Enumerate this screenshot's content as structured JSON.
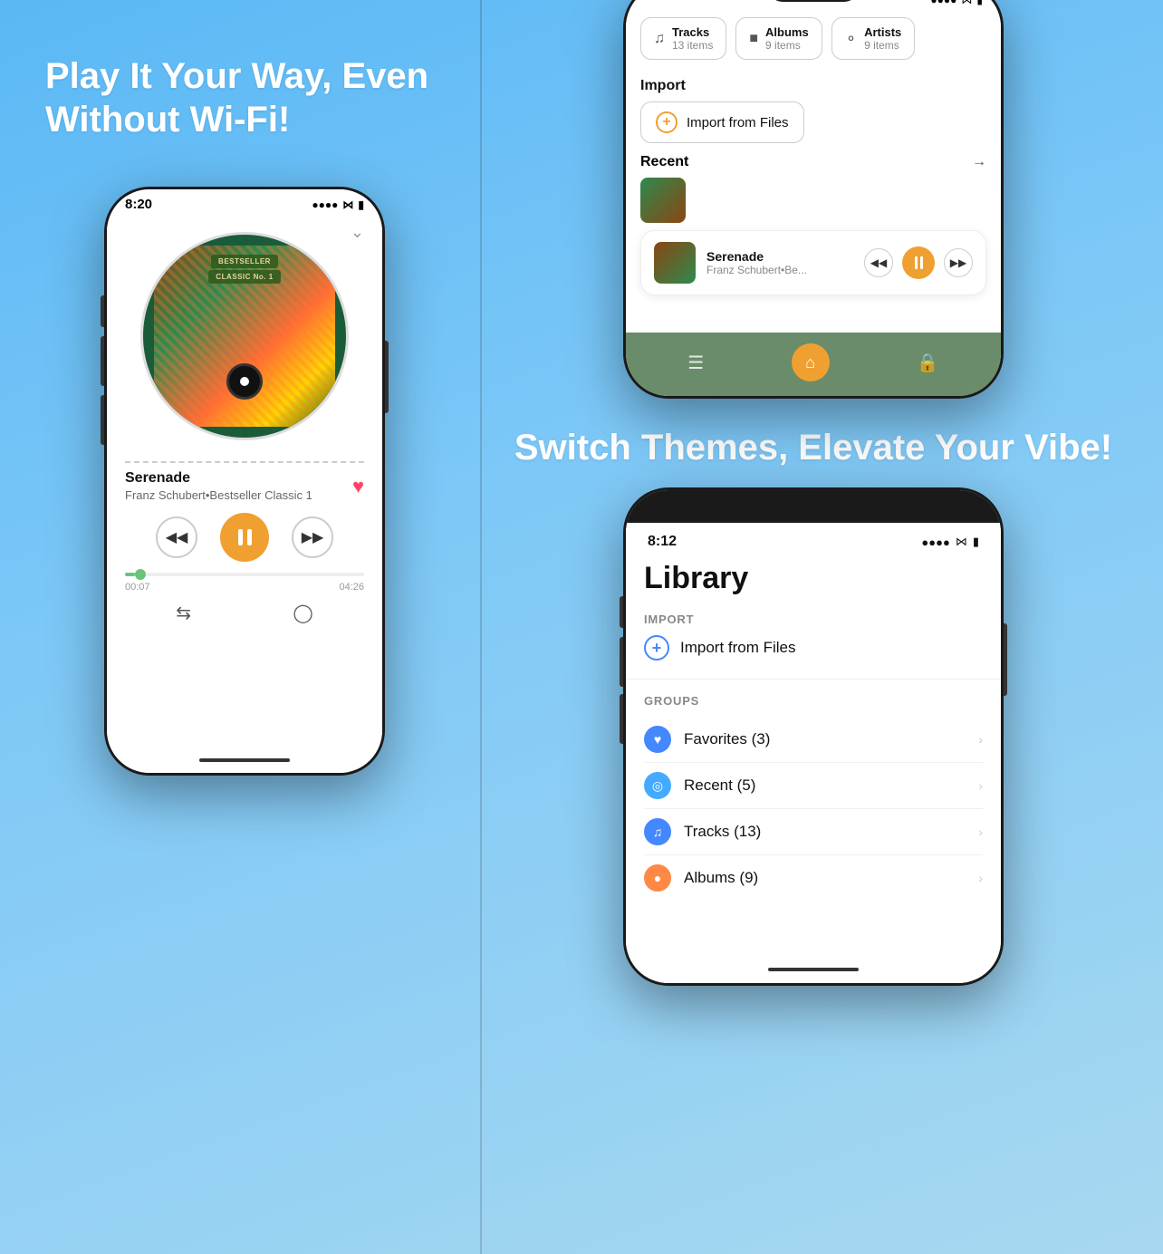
{
  "left": {
    "headline": "Play It Your Way, Even Without Wi-Fi!",
    "phone1": {
      "status_time": "8:20",
      "track_title": "Serenade",
      "track_artist": "Franz Schubert•Bestseller Classic 1",
      "time_current": "00:07",
      "time_total": "04:26",
      "album_label_1": "BESTSELLER",
      "album_label_2": "CLASSIC No. 1"
    }
  },
  "right": {
    "headline2": "Switch Themes, Elevate Your Vibe!",
    "phone2": {
      "tabs": [
        {
          "icon": "♩",
          "name": "Tracks",
          "count": "13 items"
        },
        {
          "icon": "▭",
          "name": "Albums",
          "count": "9 items"
        },
        {
          "icon": "♟",
          "name": "Artists",
          "count": "9 items"
        }
      ],
      "import_section": "Import",
      "import_btn": "Import from Files",
      "recent_label": "Recent",
      "now_playing_title": "Serenade",
      "now_playing_artist": "Franz Schubert•Be..."
    },
    "phone3": {
      "status_time": "8:12",
      "title": "Library",
      "import_section": "IMPORT",
      "import_label": "Import from Files",
      "groups_section": "GROUPS",
      "groups": [
        {
          "icon": "♥",
          "color": "blue",
          "label": "Favorites (3)"
        },
        {
          "icon": "🕐",
          "color": "lblue",
          "label": "Recent (5)"
        },
        {
          "icon": "♪",
          "color": "music",
          "label": "Tracks (13)"
        },
        {
          "icon": "●",
          "color": "orange",
          "label": "Albums (9)"
        }
      ]
    }
  }
}
